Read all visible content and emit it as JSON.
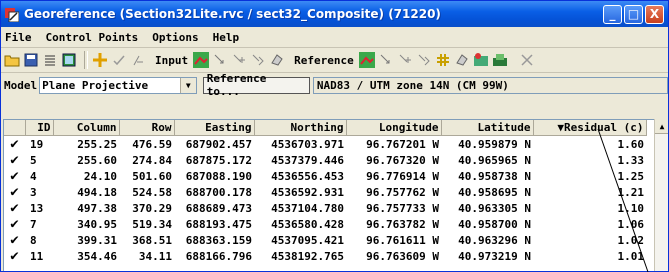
{
  "window": {
    "title": "Georeference (Section32Lite.rvc / sect32_Composite) (71220)",
    "controls": {
      "minimize": "_",
      "maximize": "□",
      "close": "X"
    }
  },
  "menu": [
    "File",
    "Control Points",
    "Options",
    "Help"
  ],
  "toolbar": {
    "input_label": "Input",
    "reference_label": "Reference",
    "icons": [
      "open-icon",
      "save-icon",
      "list-icon",
      "table-icon",
      "crosshair-icon",
      "check-icon",
      "delete-point-icon",
      "input-view-icon",
      "input-arrow-icon",
      "input-add-icon",
      "input-move-icon",
      "input-delete-icon",
      "reference-view-icon",
      "reference-arrow-icon",
      "reference-add-icon",
      "reference-move-icon",
      "reference-hash-icon",
      "reference-delete-icon",
      "reference-image-icon",
      "reference-stack-icon",
      "cancel-x-icon"
    ]
  },
  "model": {
    "label": "Model",
    "selected": "Plane Projective",
    "reference_button": "Reference to...",
    "reference_value": "NAD83 / UTM zone 14N (CM 99W)"
  },
  "table": {
    "columns": [
      "",
      "ID",
      "Column",
      "Row",
      "Easting",
      "Northing",
      "Longitude",
      "Latitude",
      "▼Residual (c)"
    ],
    "rows": [
      {
        "check": "✔",
        "id": "19",
        "column": "255.25",
        "row": "476.59",
        "easting": "687902.457",
        "northing": "4536703.971",
        "longitude": "96.767201 W",
        "latitude": "40.959879 N",
        "residual": "1.60"
      },
      {
        "check": "✔",
        "id": "5",
        "column": "255.60",
        "row": "274.84",
        "easting": "687875.172",
        "northing": "4537379.446",
        "longitude": "96.767320 W",
        "latitude": "40.965965 N",
        "residual": "1.33"
      },
      {
        "check": "✔",
        "id": "4",
        "column": "24.10",
        "row": "501.60",
        "easting": "687088.190",
        "northing": "4536556.453",
        "longitude": "96.776914 W",
        "latitude": "40.958738 N",
        "residual": "1.25"
      },
      {
        "check": "✔",
        "id": "3",
        "column": "494.18",
        "row": "524.58",
        "easting": "688700.178",
        "northing": "4536592.931",
        "longitude": "96.757762 W",
        "latitude": "40.958695 N",
        "residual": "1.21"
      },
      {
        "check": "✔",
        "id": "13",
        "column": "497.38",
        "row": "370.29",
        "easting": "688689.473",
        "northing": "4537104.780",
        "longitude": "96.757733 W",
        "latitude": "40.963305 N",
        "residual": "1.10"
      },
      {
        "check": "✔",
        "id": "7",
        "column": "340.95",
        "row": "519.34",
        "easting": "688193.475",
        "northing": "4536580.428",
        "longitude": "96.763782 W",
        "latitude": "40.958700 N",
        "residual": "1.06"
      },
      {
        "check": "✔",
        "id": "8",
        "column": "399.31",
        "row": "368.51",
        "easting": "688363.159",
        "northing": "4537095.421",
        "longitude": "96.761611 W",
        "latitude": "40.963296 N",
        "residual": "1.02"
      },
      {
        "check": "✔",
        "id": "11",
        "column": "354.46",
        "row": "34.11",
        "easting": "688166.796",
        "northing": "4538192.765",
        "longitude": "96.763609 W",
        "latitude": "40.973219 N",
        "residual": "1.01"
      }
    ]
  }
}
